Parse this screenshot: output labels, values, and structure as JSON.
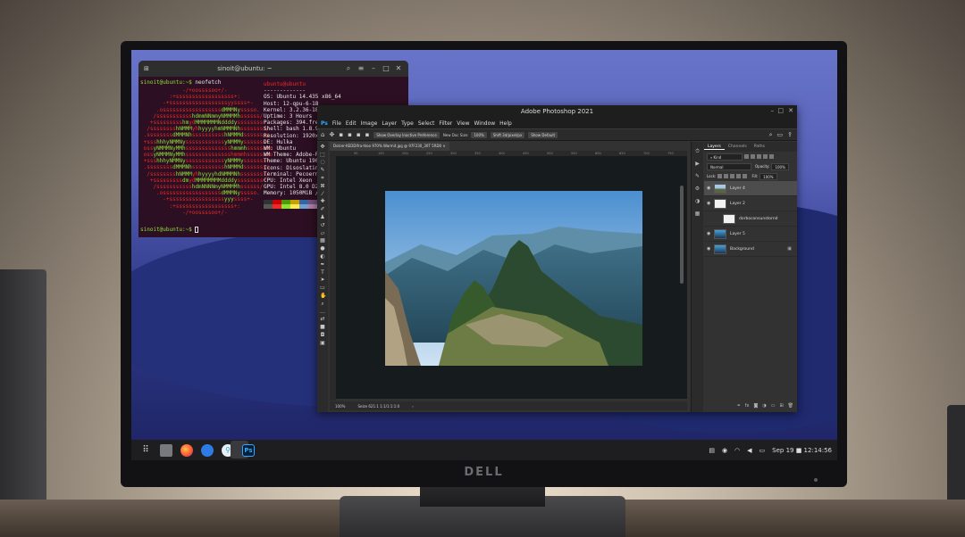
{
  "monitor": {
    "brand": "DELL"
  },
  "terminal": {
    "title": "sinoit@ubuntu: ~",
    "window_buttons": [
      "⌕",
      "≡",
      "–",
      "□",
      "✕"
    ],
    "prompt": "sinoit@ubuntu:~$",
    "command": "neofetch",
    "user_host": "ubuntu@ubuntu",
    "separator": "-------------",
    "info_lines": [
      "OS: Ubuntu 14.435 x86_64",
      "Host: 12-qpu-6-18",
      "Kernel: 3.2.36-18",
      "Uptime: 3 Hours",
      "Packages: 394.free",
      "Shell: bash 1.8.9",
      "Resolution: 1920x1080",
      "DE: Hulka",
      "WM: Ubuntu",
      "WM Theme: Adobe-R",
      "Theme: Ubuntu 190",
      "Icons: Disoslatin",
      "Terminal: Pecoern",
      "CPU: Intel Xeon",
      "GPU: Intel 8.0 D2",
      "Memory: 1050MiB /"
    ],
    "palette_row1": [
      "#2e3436",
      "#cc0000",
      "#4e9a06",
      "#c4a000",
      "#3465a4",
      "#75507b",
      "#06989a",
      "#d3d7cf"
    ],
    "palette_row2": [
      "#555753",
      "#ef2929",
      "#8ae234",
      "#fce94f",
      "#729fcf",
      "#ad7fa8",
      "#34e2e2",
      "#eeeeec"
    ],
    "end_prompt": "sinoit@ubuntu:~$"
  },
  "photoshop": {
    "title": "Adobe Photoshop 2021",
    "window_buttons": [
      "–",
      "□",
      "✕"
    ],
    "menu": [
      "File",
      "Edit",
      "Image",
      "Layer",
      "Type",
      "Select",
      "Filter",
      "View",
      "Window",
      "Help"
    ],
    "options": {
      "sample": "Show Overlay Inactive Preference",
      "size_label": "New Doc Size:",
      "size_value": "100%",
      "shift_label": "Shift 3d/pixel/px",
      "default_button": "Show Default"
    },
    "doc_tab": "Dolcer-KEDDifra-hloo 970% Warmit.jpg @ 97F230_30T 5RD0 ×",
    "ruler_ticks": [
      "90",
      "150",
      "200",
      "250",
      "300",
      "350",
      "400",
      "450",
      "500",
      "550",
      "600",
      "650",
      "700",
      "750"
    ],
    "status": {
      "zoom": "100%",
      "doc": "Seize 621:1 1:1/1:1:1:0",
      "arrow": "›"
    },
    "layers_panel": {
      "tabs": [
        "Layers",
        "Channels",
        "Paths"
      ],
      "kind_label": "Kind",
      "blend_mode": "Normal",
      "opacity_label": "Opacity:",
      "opacity_value": "100%",
      "lock_label": "Lock:",
      "fill_label": "Fill:",
      "fill_value": "100%",
      "layers": [
        {
          "name": "Layer 4",
          "thumb": "img",
          "selected": true,
          "visible": true
        },
        {
          "name": "Layer 2",
          "thumb": "white",
          "selected": false,
          "visible": true
        },
        {
          "name": "dorboconsunstornd",
          "thumb": "white",
          "selected": false,
          "visible": false
        },
        {
          "name": "Layer 5",
          "thumb": "grad",
          "selected": false,
          "visible": true
        },
        {
          "name": "Background",
          "thumb": "grad",
          "selected": false,
          "visible": true,
          "locked": true
        }
      ]
    }
  },
  "taskbar": {
    "apps": [
      "app-grid",
      "files",
      "firefox",
      "mail",
      "pin",
      "photoshop"
    ],
    "ps_label": "Ps",
    "clock": "Sep 19 ■ 12:14:56"
  },
  "colors": {
    "ps_accent": "#31a8ff",
    "terminal_bg": "#2c0f22",
    "ascii_red": "#ef2929",
    "ascii_green": "#8ae234",
    "desktop_blue": "#3b4594"
  }
}
